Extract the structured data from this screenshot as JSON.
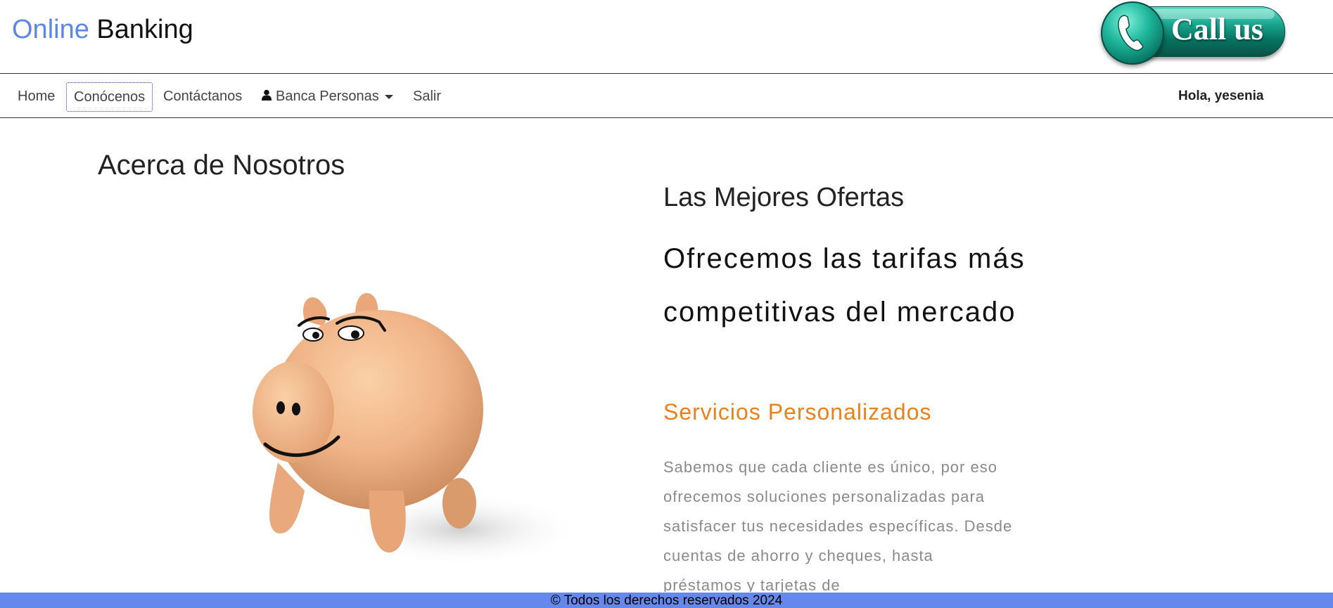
{
  "header": {
    "brand_first": "Online",
    "brand_second": "Banking",
    "call_label": "Call us"
  },
  "nav": {
    "items": [
      {
        "label": "Home"
      },
      {
        "label": "Conócenos",
        "active": true
      },
      {
        "label": "Contáctanos"
      },
      {
        "label": "Banca Personas",
        "icon": "user-icon",
        "has_dropdown": true
      },
      {
        "label": "Salir"
      }
    ],
    "greeting": "Hola, yesenia"
  },
  "main": {
    "title": "Acerca de Nosotros",
    "offers_title": "Las Mejores Ofertas",
    "offers_subtitle": "Ofrecemos las tarifas más competitivas del mercado",
    "services_title": "Servicios Personalizados",
    "services_text": "Sabemos que cada cliente es único, por eso ofrecemos soluciones personalizadas para satisfacer tus necesidades específicas. Desde cuentas de ahorro y cheques, hasta préstamos y tarjetas de"
  },
  "footer": {
    "text": "© Todos los derechos reservados 2024"
  },
  "colors": {
    "brand_blue": "#5d87e6",
    "services_orange": "#e8821e",
    "footer_bg": "#6488ec",
    "call_green": "#1aa58f"
  }
}
